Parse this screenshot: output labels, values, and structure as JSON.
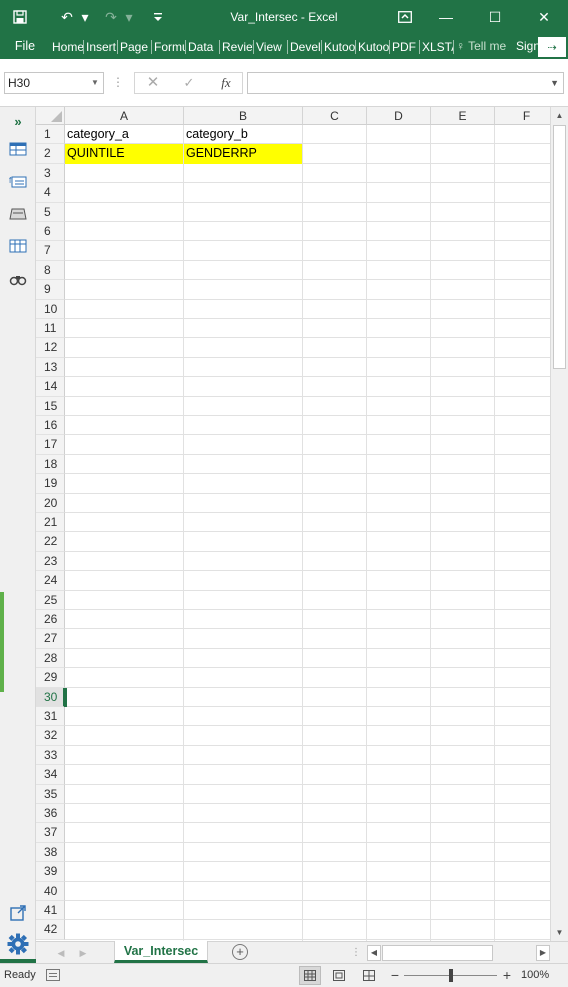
{
  "window": {
    "title": "Var_Intersec - Excel",
    "minimize": "—",
    "maximize": "☐",
    "close": "✕",
    "ribbon_display": "⬓"
  },
  "ribbon": {
    "file": "File",
    "tabs": [
      "Home",
      "Insert",
      "Page Layout",
      "Formulas",
      "Data",
      "Review",
      "View",
      "Developer",
      "Kutools",
      "Kutools Plus",
      "PDF",
      "XLSTAT"
    ],
    "tell_me": "Tell me",
    "sign_in": "Sign in",
    "share": "⇢"
  },
  "formula_bar": {
    "name_box": "H30",
    "cancel": "✕",
    "enter": "✓",
    "fx": "fx",
    "formula": ""
  },
  "grid": {
    "columns": [
      "A",
      "B",
      "C",
      "D",
      "E",
      "F"
    ],
    "rows": [
      "1",
      "2",
      "3",
      "4",
      "5",
      "6",
      "7",
      "8",
      "9",
      "10",
      "11",
      "12",
      "13",
      "14",
      "15",
      "16",
      "17",
      "18",
      "19",
      "20",
      "21",
      "22",
      "23",
      "24",
      "25",
      "26",
      "27",
      "28",
      "29",
      "30",
      "31",
      "32",
      "33",
      "34",
      "35",
      "36",
      "37",
      "38",
      "39",
      "40",
      "41",
      "42"
    ],
    "active_row": "30",
    "cells": {
      "A1": "category_a",
      "B1": "category_b",
      "A2": "QUINTILE",
      "B2": "GENDERRP"
    },
    "highlight_color": "#ffff00"
  },
  "sheets": {
    "tabs": [
      "Var_Intersec"
    ],
    "active": "Var_Intersec",
    "add": "+"
  },
  "status": {
    "ready": "Ready",
    "zoom": "100%",
    "zoom_fraction": 0.5
  },
  "colors": {
    "accent": "#217346",
    "panel_green": "#5fb14a"
  }
}
